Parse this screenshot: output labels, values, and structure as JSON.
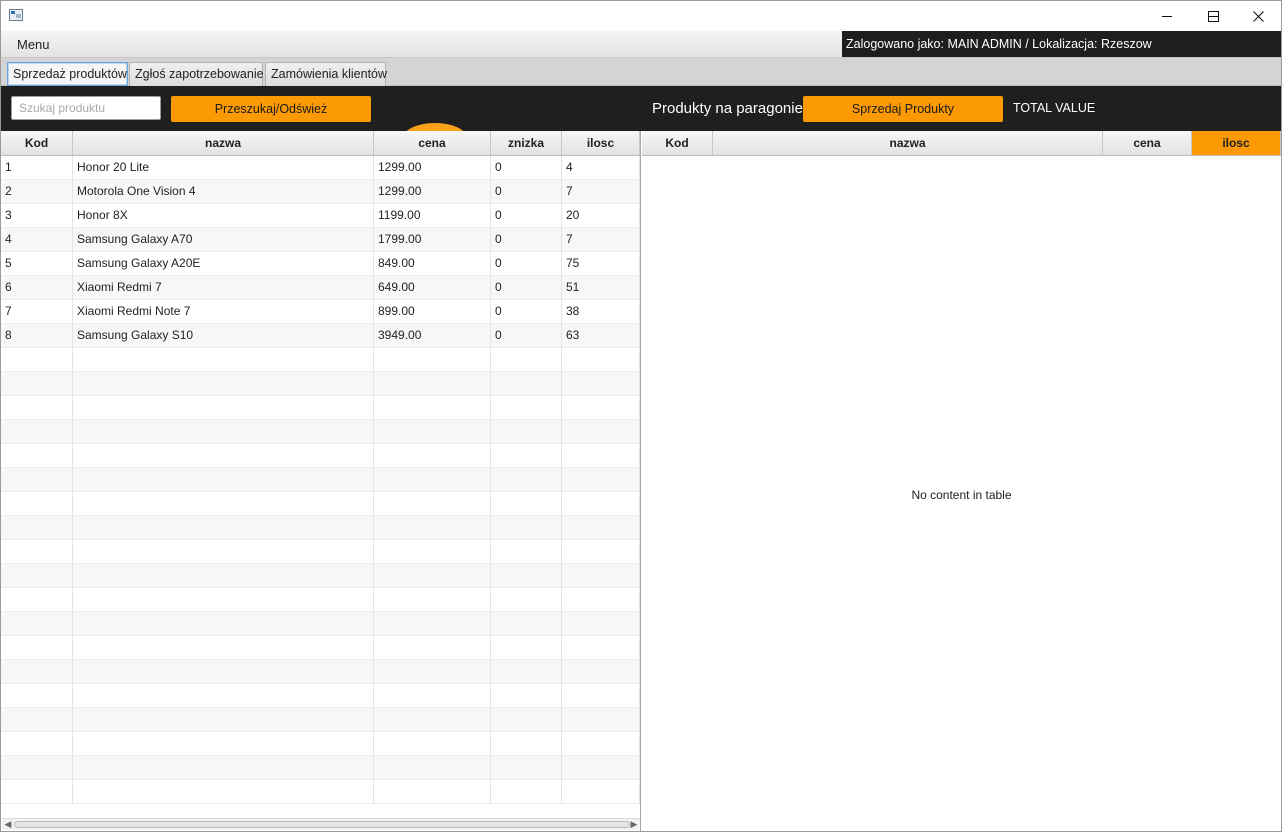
{
  "menu": {
    "label": "Menu"
  },
  "login_info": "Zalogowano jako: MAIN ADMIN / Lokalizacja: Rzeszow",
  "tabs": [
    {
      "label": "Sprzedaż produktów",
      "active": true
    },
    {
      "label": "Zgłoś zapotrzebowanie",
      "active": false
    },
    {
      "label": "Zamówienia klientów",
      "active": false
    }
  ],
  "toolbar": {
    "search_placeholder": "Szukaj produktu",
    "search_value": "",
    "search_button": "Przeszukaj/Odśwież",
    "receipt_label": "Produkty na paragonie",
    "sell_button": "Sprzedaj Produkty",
    "total_value": "TOTAL VALUE"
  },
  "products_table": {
    "columns": [
      "Kod",
      "nazwa",
      "cena",
      "znizka",
      "ilosc"
    ],
    "rows": [
      [
        "1",
        "Honor 20 Lite",
        "1299.00",
        "0",
        "4"
      ],
      [
        "2",
        "Motorola One Vision 4",
        "1299.00",
        "0",
        "7"
      ],
      [
        "3",
        "Honor 8X",
        "1199.00",
        "0",
        "20"
      ],
      [
        "4",
        "Samsung Galaxy A70",
        "1799.00",
        "0",
        "7"
      ],
      [
        "5",
        "Samsung Galaxy A20E",
        "849.00",
        "0",
        "75"
      ],
      [
        "6",
        "Xiaomi Redmi 7",
        "649.00",
        "0",
        "51"
      ],
      [
        "7",
        "Xiaomi Redmi Note 7",
        "899.00",
        "0",
        "38"
      ],
      [
        "8",
        "Samsung Galaxy S10",
        "3949.00",
        "0",
        "63"
      ]
    ]
  },
  "receipt_table": {
    "columns": [
      "Kod",
      "nazwa",
      "cena",
      "ilosc"
    ],
    "sorted_column": "ilosc",
    "empty_text": "No content in table"
  },
  "colors": {
    "accent": "#fb9a05",
    "toolbar_bg": "#1f1f1f",
    "login_bg": "#1e1e1e"
  }
}
